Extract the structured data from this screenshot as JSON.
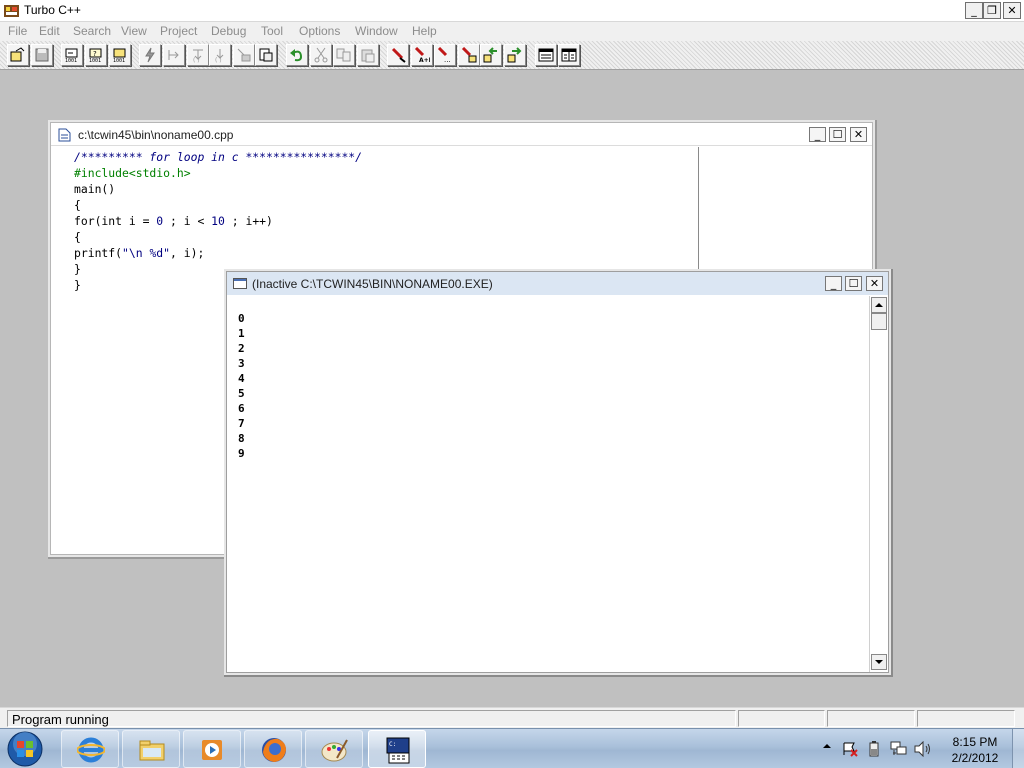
{
  "app": {
    "title": "Turbo C++"
  },
  "menu": [
    "File",
    "Edit",
    "Search",
    "View",
    "Project",
    "Debug",
    "Tool",
    "Options",
    "Window",
    "Help"
  ],
  "toolbar": {
    "icons": [
      "open-project-icon",
      "save-icon",
      "find-icon",
      "find-next-icon",
      "replace-icon",
      "compile-icon",
      "step-over-icon",
      "trace-into-icon",
      "run-to-cursor-icon",
      "toggle-breakpoint-icon",
      "build-icon",
      "undo-icon",
      "cut-icon",
      "copy-icon",
      "paste-icon",
      "inspect-icon",
      "evaluate-icon",
      "watch-icon",
      "breakpoint-icon",
      "previous-message-icon",
      "next-message-icon",
      "window-tile-icon",
      "window-cascade-icon"
    ]
  },
  "editor": {
    "title": "c:\\tcwin45\\bin\\noname00.cpp",
    "lines": [
      "/********* for loop in c ****************/",
      "#include<stdio.h>",
      "main()",
      "{",
      "for(int i = 0 ; i < 10 ; i++)",
      "{",
      "printf(\"\\n %d\", i);",
      "}",
      "}"
    ]
  },
  "output": {
    "title": "(Inactive C:\\TCWIN45\\BIN\\NONAME00.EXE)",
    "lines": [
      "0",
      "1",
      "2",
      "3",
      "4",
      "5",
      "6",
      "7",
      "8",
      "9"
    ]
  },
  "status": {
    "text": "Program running"
  },
  "taskbar": {
    "buttons": [
      "internet-explorer-icon",
      "windows-explorer-icon",
      "media-player-icon",
      "firefox-icon",
      "paint-icon",
      "turbo-cpp-icon"
    ],
    "clock_time": "8:15 PM",
    "clock_date": "2/2/2012"
  }
}
